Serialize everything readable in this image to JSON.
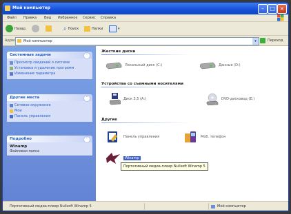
{
  "window": {
    "title": "Мой компьютер"
  },
  "menubar": {
    "items": [
      "Файл",
      "Правка",
      "Вид",
      "Избранное",
      "Сервис",
      "Справка"
    ]
  },
  "toolbar": {
    "back": "Назад",
    "search": "Поиск",
    "folders": "Папки"
  },
  "addressbar": {
    "label": "Адрес",
    "value": "Мой компьютер",
    "go_label": "Переход"
  },
  "sidebar": {
    "system_tasks": {
      "title": "Системные задачи",
      "items": [
        "Просмотр сведений о системе",
        "Установка и удаление программ",
        "Изменение параметра"
      ]
    },
    "other_places": {
      "title": "Другие места",
      "items": [
        "Сетевое окружение",
        "Мои",
        "Панель управления"
      ]
    },
    "details": {
      "title": "Подробно",
      "name": "Winamp",
      "type": "Файловая папка"
    }
  },
  "main": {
    "hdd_title": "Жесткие диски",
    "hdd_items": [
      "Локальный диск (C:)",
      "Данные (D:)"
    ],
    "removable_title": "Устройства со съемными носителями",
    "removable_items": [
      "Диск 3,5 (A:)",
      "DVD-дисковод (E:)"
    ],
    "other_title": "Другие",
    "other_items": [
      "Панель управления",
      "Моб. телефон",
      "Winamp"
    ],
    "tooltip": "Портативный медиа-плеер Nullsoft Winamp 5"
  },
  "statusbar": {
    "left": "Портативный медиа-плеер Nullsoft Winamp 5",
    "right": "Мой компьютер"
  }
}
